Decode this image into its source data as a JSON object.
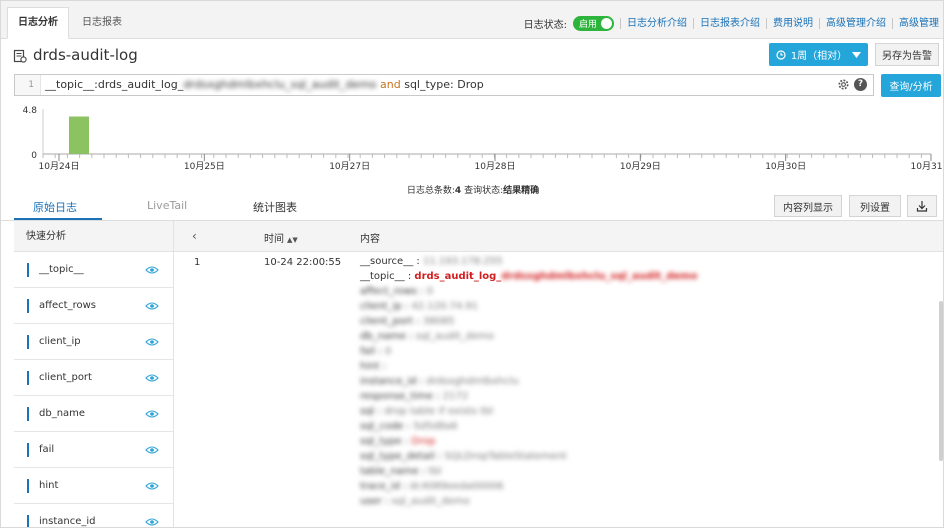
{
  "tabs": [
    {
      "label": "日志分析",
      "active": true
    },
    {
      "label": "日志报表",
      "active": false
    }
  ],
  "header": {
    "status_label": "日志状态:",
    "toggle_label": "启用",
    "links": [
      "日志分析介绍",
      "日志报表介绍",
      "费用说明",
      "高级管理介绍",
      "高级管理"
    ]
  },
  "logstore": {
    "title": "drds-audit-log",
    "time_range": "1周（相对）",
    "save_as_alert": "另存为告警"
  },
  "query": {
    "line_number": "1",
    "prefix": "__topic__:drds_audit_log_",
    "redacted": "drdsxghdmlbxhclu_sql_audit_demo",
    "keyword": "and",
    "suffix": "sql_type: Drop",
    "search_button": "查询/分析"
  },
  "chart_data": {
    "type": "bar",
    "title": "",
    "xlabel": "",
    "ylabel": "",
    "ylim": [
      0,
      4.8
    ],
    "yticks": [
      "4.8",
      "0"
    ],
    "xticks": [
      "10月24日",
      "10月25日",
      "10月27日",
      "10月28日",
      "10月29日",
      "10月30日",
      "10月31日"
    ],
    "series": [
      {
        "name": "",
        "values": [
          {
            "x": "10-24 22:00",
            "y": 4
          }
        ]
      }
    ],
    "bar_color": "#8dc262",
    "grid": false
  },
  "summary": {
    "count_label": "日志总条数:",
    "count": "4",
    "status_label": "查询状态:",
    "status": "结果精确"
  },
  "subtabs": [
    "原始日志",
    "LiveTail",
    "统计图表"
  ],
  "actions": {
    "content_display": "内容列显示",
    "column_settings": "列设置"
  },
  "quick_analysis": {
    "title": "快速分析",
    "fields": [
      "__topic__",
      "affect_rows",
      "client_ip",
      "client_port",
      "db_name",
      "fail",
      "hint",
      "instance_id"
    ]
  },
  "table": {
    "col_time": "时间",
    "col_content": "内容",
    "rows": [
      {
        "index": "1",
        "time": "10-24 22:00:55",
        "fields": [
          {
            "k": "__source__",
            "v": "11.193.178.255"
          },
          {
            "k": "__topic__",
            "v": "drds_audit_log_drdsxghdmlbxhclu_sql_audit_demo"
          },
          {
            "k": "affect_rows",
            "v": "0"
          },
          {
            "k": "client_ip",
            "v": "42.120.74.91"
          },
          {
            "k": "client_port",
            "v": "38085"
          },
          {
            "k": "db_name",
            "v": "sql_audit_demo"
          },
          {
            "k": "fail",
            "v": "0"
          },
          {
            "k": "hint",
            "v": ""
          },
          {
            "k": "instance_id",
            "v": "drdsxghdmlbxhclu"
          },
          {
            "k": "response_time",
            "v": "2172"
          },
          {
            "k": "sql",
            "v": "drop table if exists tbl"
          },
          {
            "k": "sql_code",
            "v": "5d5d8a6"
          },
          {
            "k": "sql_type",
            "v": "Drop"
          },
          {
            "k": "sql_type_detail",
            "v": "SQLDropTableStatement"
          },
          {
            "k": "table_name",
            "v": "tbl"
          },
          {
            "k": "trace_id",
            "v": "dc4089eeda00006"
          },
          {
            "k": "user",
            "v": "sql_audit_demo"
          }
        ]
      }
    ]
  }
}
